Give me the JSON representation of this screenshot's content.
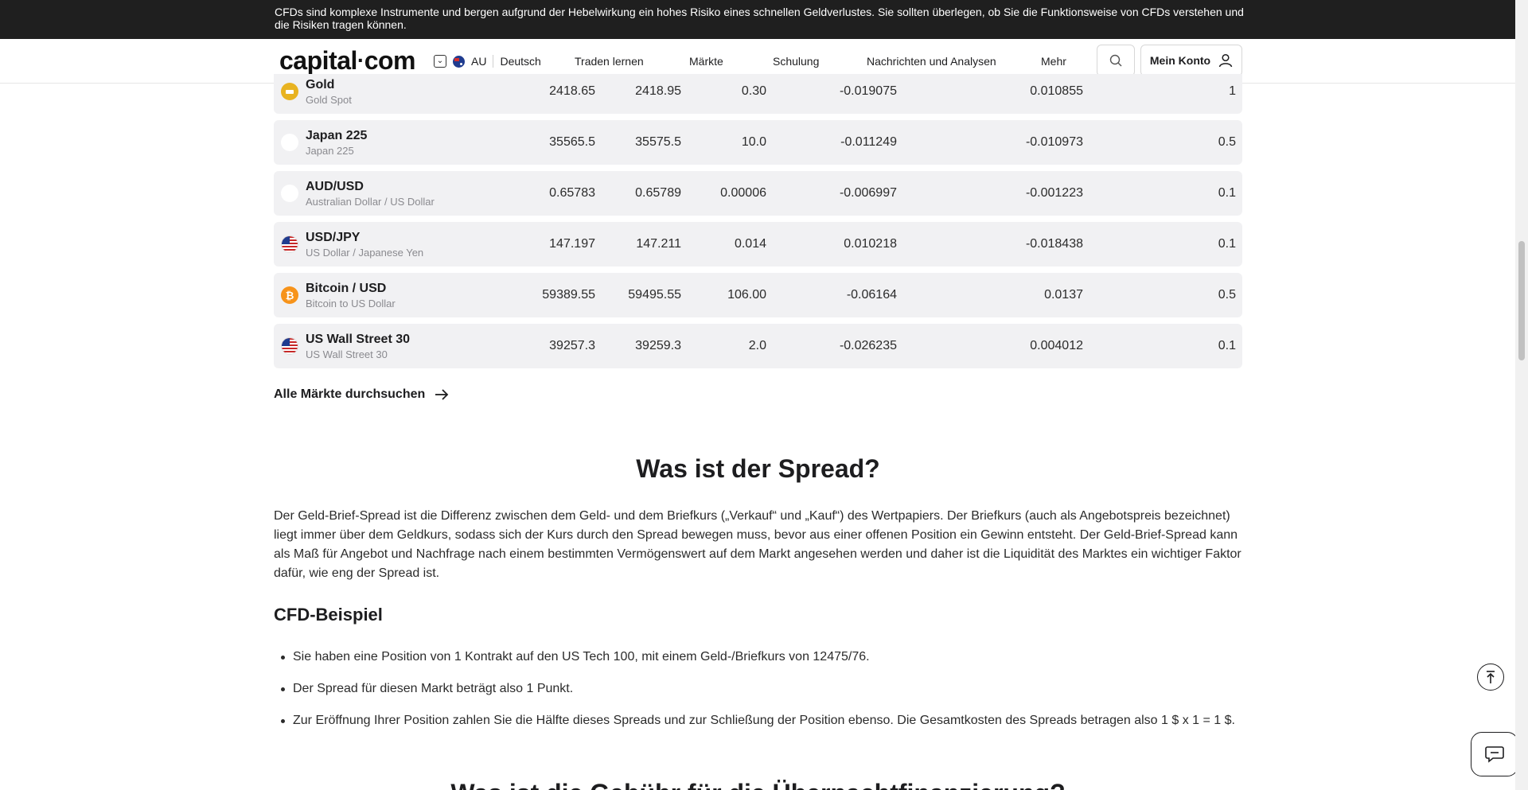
{
  "risk_banner": "CFDs sind komplexe Instrumente und bergen aufgrund der Hebelwirkung ein hohes Risiko eines schnellen Geldverlustes. Sie sollten überlegen, ob Sie die Funktionsweise von CFDs verstehen und die Risiken tragen können.",
  "header": {
    "logo": "capital",
    "logo_suffix": "com",
    "region": "AU",
    "language": "Deutsch",
    "nav": [
      "Traden lernen",
      "Märkte",
      "Schulung",
      "Nachrichten und Analysen",
      "Mehr"
    ],
    "account": "Mein Konto"
  },
  "markets": [
    {
      "name": "Gold",
      "sub": "Gold Spot",
      "icon": "gold-bar-icon",
      "v1": "2418.65",
      "v2": "2418.95",
      "v3": "0.30",
      "v4": "-0.019075",
      "v5": "0.010855",
      "v6": "1"
    },
    {
      "name": "Japan 225",
      "sub": "Japan 225",
      "icon": "capital-c-icon",
      "v1": "35565.5",
      "v2": "35575.5",
      "v3": "10.0",
      "v4": "-0.011249",
      "v5": "-0.010973",
      "v6": "0.5"
    },
    {
      "name": "AUD/USD",
      "sub": "Australian Dollar / US Dollar",
      "icon": "capital-c-icon",
      "v1": "0.65783",
      "v2": "0.65789",
      "v3": "0.00006",
      "v4": "-0.006997",
      "v5": "-0.001223",
      "v6": "0.1"
    },
    {
      "name": "USD/JPY",
      "sub": "US Dollar / Japanese Yen",
      "icon": "us-flag-icon",
      "v1": "147.197",
      "v2": "147.211",
      "v3": "0.014",
      "v4": "0.010218",
      "v5": "-0.018438",
      "v6": "0.1"
    },
    {
      "name": "Bitcoin / USD",
      "sub": "Bitcoin to US Dollar",
      "icon": "bitcoin-icon",
      "v1": "59389.55",
      "v2": "59495.55",
      "v3": "106.00",
      "v4": "-0.06164",
      "v5": "0.0137",
      "v6": "0.5"
    },
    {
      "name": "US Wall Street 30",
      "sub": "US Wall Street 30",
      "icon": "us-flag-icon",
      "v1": "39257.3",
      "v2": "39259.3",
      "v3": "2.0",
      "v4": "-0.026235",
      "v5": "0.004012",
      "v6": "0.1"
    }
  ],
  "all_markets_link": "Alle Märkte durchsuchen",
  "section_title": "Was ist der Spread?",
  "intro": "Der Geld-Brief-Spread ist die Differenz zwischen dem Geld- und dem Briefkurs („Verkauf“ und „Kauf“) des Wertpapiers. Der Briefkurs (auch als Angebotspreis bezeichnet) liegt immer über dem Geldkurs, sodass sich der Kurs durch den Spread bewegen muss, bevor aus einer offenen Position ein Gewinn entsteht. Der Geld-Brief-Spread kann als Maß für Angebot und Nachfrage nach einem bestimmten Vermögenswert auf dem Markt angesehen werden und daher ist die Liquidität des Marktes ein wichtiger Faktor dafür, wie eng der Spread ist.",
  "example_heading": "CFD-Beispiel",
  "bullets": [
    "Sie haben eine Position von 1 Kontrakt auf den US Tech 100, mit einem Geld-/Briefkurs von 12475/76.",
    "Der Spread für diesen Markt beträgt also 1 Punkt.",
    "Zur Eröffnung Ihrer Position zahlen Sie die Hälfte dieses Spreads und zur Schließung der Position ebenso. Die Gesamtkosten des Spreads betragen also 1 $ x 1 = 1 $."
  ],
  "next_heading": "Was ist die Gebühr für die Übernachtfinanzierung?"
}
